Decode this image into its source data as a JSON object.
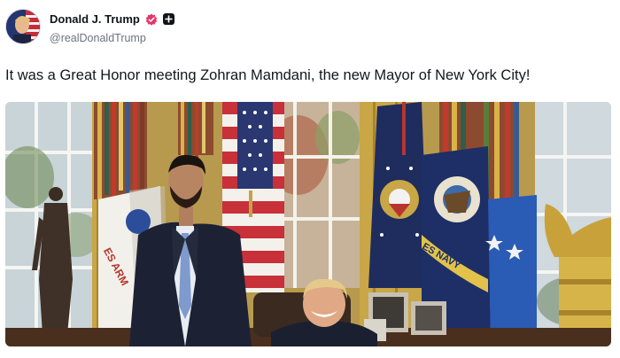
{
  "post": {
    "author_name": "Donald J. Trump",
    "handle": "@realDonaldTrump",
    "text": "It was a Great Honor meeting Zohran Mamdani, the new Mayor of New York City!"
  },
  "photo": {
    "flag_text_left": "ES ARM",
    "flag_text_navy": "ES NAVY"
  },
  "colors": {
    "verified_badge": "#e5366b",
    "handle": "#6b7280",
    "text": "#14171a"
  }
}
